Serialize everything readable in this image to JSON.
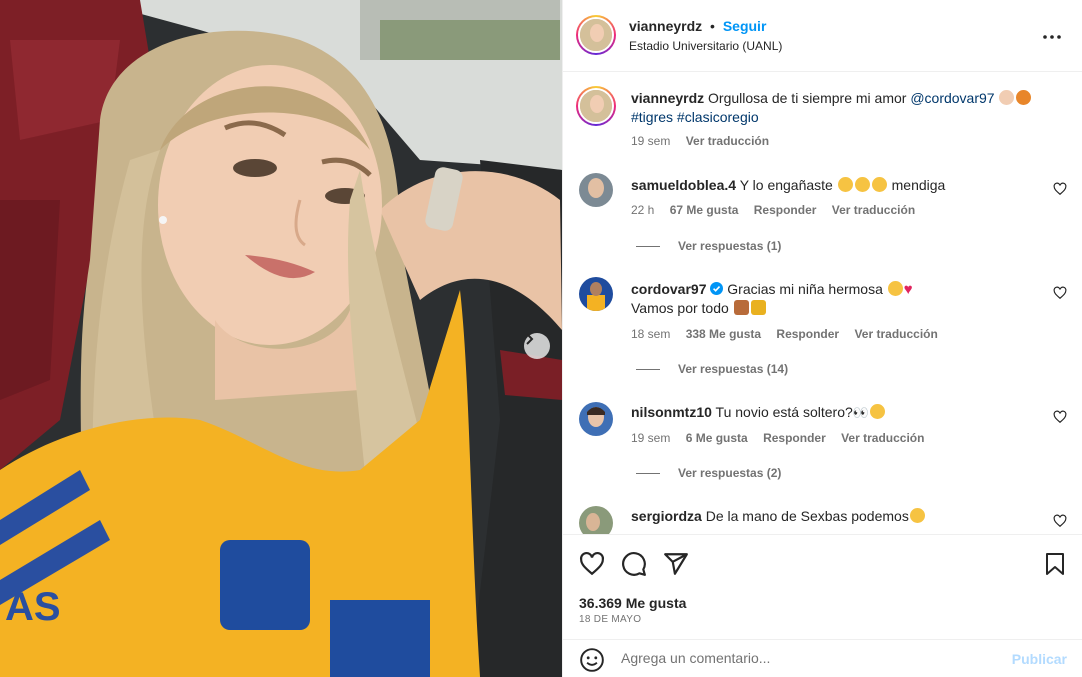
{
  "post": {
    "username": "vianneyrdz",
    "separator": "•",
    "follow_label": "Seguir",
    "location": "Estadio Universitario (UANL)",
    "caption": {
      "text": "Orgullosa de ti siempre mi amor",
      "mention": "@cordovar97",
      "hashtags": "#tigres #clasicoregio",
      "time": "19 sem",
      "translate_label": "Ver traducción"
    },
    "likes": "36.369 Me gusta",
    "date": "18 DE MAYO",
    "comment_placeholder": "Agrega un comentario...",
    "publish_label": "Publicar"
  },
  "comments": [
    {
      "username": "samueldoblea.4",
      "text_a": "Y lo engañaste",
      "text_b": "mendiga",
      "time": "22 h",
      "likes": "67 Me gusta",
      "reply_label": "Responder",
      "translate_label": "Ver traducción",
      "replies_label": "Ver respuestas (1)"
    },
    {
      "username": "cordovar97",
      "verified": true,
      "text_a": "Gracias mi niña hermosa",
      "text_b": "Vamos por todo",
      "time": "18 sem",
      "likes": "338 Me gusta",
      "reply_label": "Responder",
      "translate_label": "Ver traducción",
      "replies_label": "Ver respuestas (14)"
    },
    {
      "username": "nilsonmtz10",
      "text_a": "Tu novio está soltero?",
      "time": "19 sem",
      "likes": "6 Me gusta",
      "reply_label": "Responder",
      "translate_label": "Ver traducción",
      "replies_label": "Ver respuestas (2)"
    },
    {
      "username": "sergiordza",
      "text_a": "De la mano de Sexbas podemos"
    }
  ],
  "icons": {
    "more": "more-horizontal-icon",
    "like": "heart-icon",
    "comment": "comment-bubble-icon",
    "share": "paper-plane-icon",
    "save": "bookmark-icon",
    "emoji": "smiley-icon",
    "next": "chevron-right-icon"
  },
  "colors": {
    "follow": "#0095f6",
    "link": "#00376b",
    "muted": "#737373",
    "publish_disabled": "#b3dbff",
    "jersey": "#f4b223"
  }
}
